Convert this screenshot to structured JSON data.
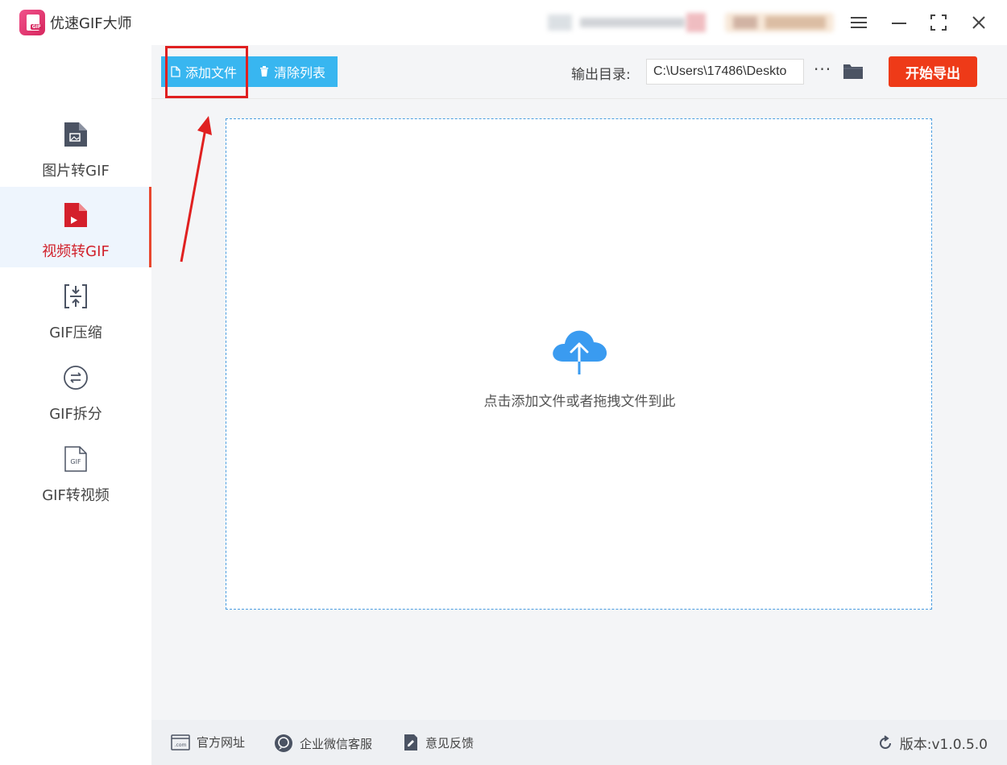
{
  "app": {
    "title": "优速GIF大师",
    "logo_text": "GIF"
  },
  "sidebar": {
    "items": [
      {
        "label": "图片转GIF",
        "icon": "image-file-icon"
      },
      {
        "label": "视频转GIF",
        "icon": "video-file-icon",
        "active": true
      },
      {
        "label": "GIF压缩",
        "icon": "compress-icon"
      },
      {
        "label": "GIF拆分",
        "icon": "split-icon"
      },
      {
        "label": "GIF转视频",
        "icon": "gif-file-icon",
        "icon_text": "GIF"
      }
    ]
  },
  "toolbar": {
    "add_file": "添加文件",
    "clear_list": "清除列表",
    "output_label": "输出目录:",
    "output_path": "C:\\Users\\17486\\Deskto",
    "more": "···",
    "export": "开始导出"
  },
  "dropzone": {
    "hint": "点击添加文件或者拖拽文件到此"
  },
  "footer": {
    "website": "官方网址",
    "wechat": "企业微信客服",
    "feedback": "意见反馈",
    "version": "版本:v1.0.5.0"
  },
  "colors": {
    "accent_blue": "#38b6f0",
    "export_red": "#ee3a18",
    "active_red": "#d1202a",
    "annotation_red": "#e02020"
  }
}
